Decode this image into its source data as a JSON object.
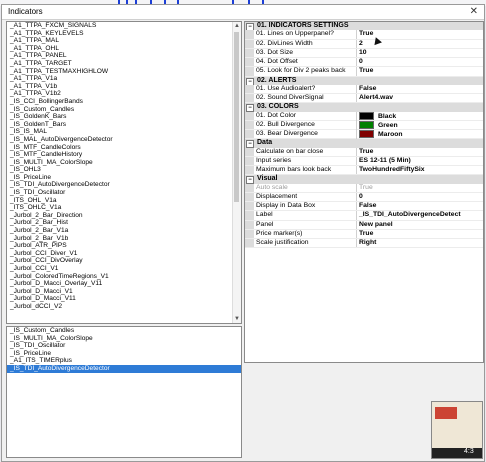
{
  "window": {
    "title": "Indicators",
    "close_glyph": "✕"
  },
  "indicator_list": [
    "_A1_TTPA_FXCM_SIGNALS",
    "_A1_TTPA_KEYLEVELS",
    "_A1_TTPA_MAL",
    "_A1_TTPA_OHL",
    "_A1_TTPA_PANEL",
    "_A1_TTPA_TARGET",
    "_A1_TTPA_TESTMAXHIGHLOW",
    "_A1_TTPA_V1a",
    "_A1_TTPA_V1b",
    "_A1_TTPA_V1b2",
    "_IS_CCI_BollingerBands",
    "_IS_Custom_Candles",
    "_IS_GoldenK_Bars",
    "_IS_GoldenT_Bars",
    "_IS_IS_MAL",
    "_IS_MAL_AutoDivergenceDetector",
    "_IS_MTF_CandleColors",
    "_IS_MTF_CandleHistory",
    "_IS_MULTI_MA_ColorSlope",
    "_IS_OHL3",
    "_IS_PriceLine",
    "_IS_TDI_AutoDivergenceDetector",
    "_IS_TDI_Oscillator",
    "_ITS_OHL_V1a",
    "_ITS_OHLC_V1a",
    "_Jurbol_2_Bar_Direction",
    "_Jurbol_2_Bar_Hist",
    "_Jurbol_2_Bar_V1a",
    "_Jurbol_2_Bar_V1b",
    "_Jurbol_ATR_PIPS",
    "_Jurbol_CCI_Diver_V1",
    "_Jurbol_CCI_DivOverlay",
    "_Jurbol_CCI_V1",
    "_Jurbol_ColoredTimeRegions_V1",
    "_Jurbol_D_Macci_Overlay_V11",
    "_Jurbol_D_Macci_V1",
    "_Jurbol_D_Macci_V11",
    "_Jurbol_dCCI_V2"
  ],
  "applied_list": {
    "items": [
      "_IS_Custom_Candles",
      "_IS_MULTI_MA_ColorSlope",
      "_IS_TDI_Oscillator",
      "_IS_PriceLine",
      "_A1_ITS_TIMERplus",
      "_IS_TDI_AutoDivergenceDetector"
    ],
    "selected_index": 5
  },
  "properties": {
    "sections": [
      {
        "title": "01. INDICATORS SETTINGS",
        "toggle": "−",
        "rows": [
          {
            "name": "01. Lines on Upperpanel?",
            "value": "True"
          },
          {
            "name": "02. DivLines Width",
            "value": "2"
          },
          {
            "name": "03. Dot Size",
            "value": "10"
          },
          {
            "name": "04. Dot Offset",
            "value": "0"
          },
          {
            "name": "05. Look for Div 2 peaks back",
            "value": "True"
          }
        ]
      },
      {
        "title": "02. ALERTS",
        "toggle": "−",
        "rows": [
          {
            "name": "01. Use Audioalert?",
            "value": "False"
          },
          {
            "name": "02. Sound DiverSignal",
            "value": "Alert4.wav"
          }
        ]
      },
      {
        "title": "03. COLORS",
        "toggle": "−",
        "rows": [
          {
            "name": "01. Dot Color",
            "value": "Black",
            "color": "#000000"
          },
          {
            "name": "02. Bull Divergence",
            "value": "Green",
            "color": "#008000"
          },
          {
            "name": "03. Bear Divergence",
            "value": "Maroon",
            "color": "#800000"
          }
        ]
      },
      {
        "title": "Data",
        "toggle": "−",
        "rows": [
          {
            "name": "Calculate on bar close",
            "value": "True"
          },
          {
            "name": "Input series",
            "value": "ES 12-11 (5 Min)"
          },
          {
            "name": "Maximum bars look back",
            "value": "TwoHundredFiftySix"
          }
        ]
      },
      {
        "title": "Visual",
        "toggle": "−",
        "rows": [
          {
            "name": "Auto scale",
            "value": "True",
            "disabled": true
          },
          {
            "name": "Displacement",
            "value": "0"
          },
          {
            "name": "Display in Data Box",
            "value": "False"
          },
          {
            "name": "Label",
            "value": "_IS_TDI_AutoDivergenceDetect"
          },
          {
            "name": "Panel",
            "value": "New panel"
          },
          {
            "name": "Price marker(s)",
            "value": "True"
          },
          {
            "name": "Scale justification",
            "value": "Right"
          }
        ]
      }
    ]
  },
  "video_overlay": {
    "timestamp": "4:3"
  }
}
